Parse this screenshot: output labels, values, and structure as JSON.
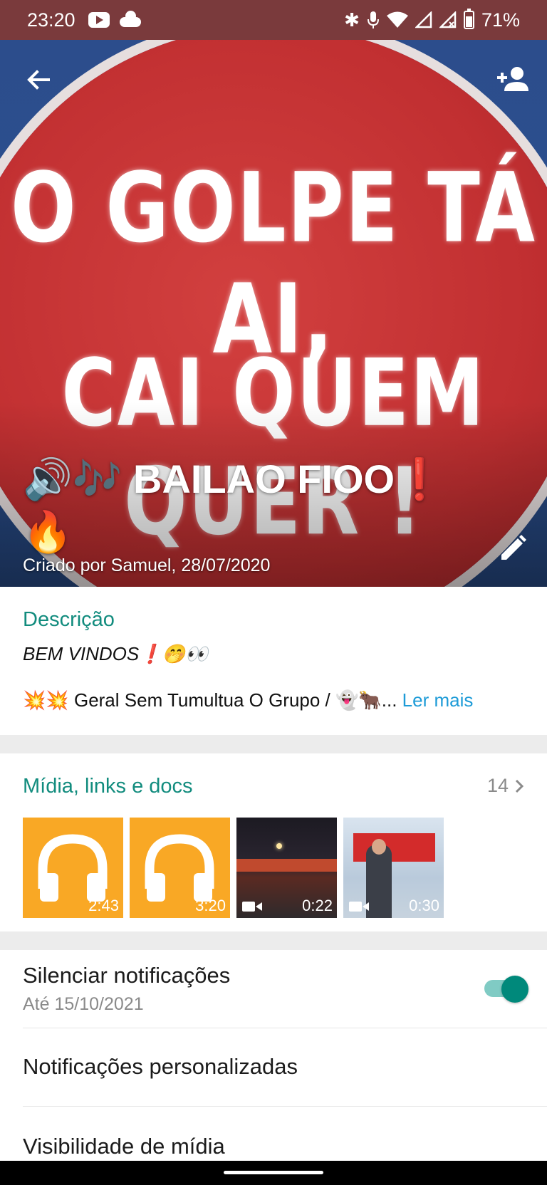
{
  "status_bar": {
    "time": "23:20",
    "battery": "71%",
    "icons": [
      "youtube-icon",
      "cloud-icon",
      "bluetooth-icon",
      "mic-icon",
      "wifi-icon",
      "signal-icon",
      "battery-icon"
    ]
  },
  "header": {
    "image_text_line1": "O GOLPE TÁ AI,",
    "image_text_line2": "CAI QUEM QUER !",
    "group_name": "🔊🎶 BAILAO FIOO❗🔥",
    "created_by": "Criado por Samuel, 28/07/2020"
  },
  "description": {
    "title": "Descrição",
    "line1": "BEM VINDOS❗🤭👀",
    "line2": "💥💥 Geral Sem Tumultua O Grupo / 👻🐂...",
    "read_more": "Ler mais"
  },
  "media": {
    "title": "Mídia, links e docs",
    "count": "14",
    "items": [
      {
        "type": "audio",
        "duration": "2:43"
      },
      {
        "type": "audio",
        "duration": "3:20"
      },
      {
        "type": "video",
        "duration": "0:22"
      },
      {
        "type": "video",
        "duration": "0:30"
      }
    ]
  },
  "settings": {
    "mute_label": "Silenciar notificações",
    "mute_until": "Até 15/10/2021",
    "mute_on": true,
    "custom_notifications": "Notificações personalizadas",
    "media_visibility": "Visibilidade de mídia"
  },
  "colors": {
    "accent": "#128c7e",
    "link": "#1d9bd7",
    "status_bar": "#7a3a3c",
    "audio_thumb": "#f9a825"
  }
}
